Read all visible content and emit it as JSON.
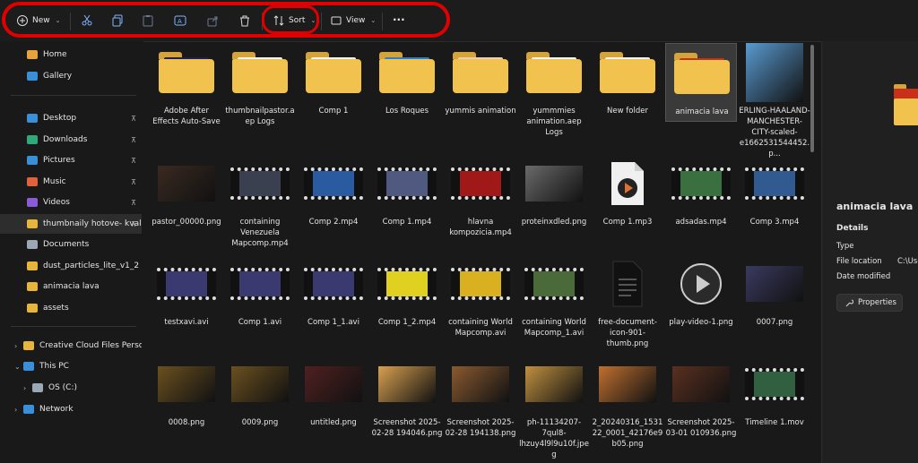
{
  "toolbar": {
    "new_label": "New",
    "sort_label": "Sort",
    "view_label": "View",
    "more_label": "···",
    "highlight_color": "#e00000"
  },
  "sidebar": {
    "items": [
      {
        "label": "Home",
        "icon": "home-icon",
        "color": "#e8a33a"
      },
      {
        "label": "Gallery",
        "icon": "gallery-icon",
        "color": "#3a8fd9"
      },
      {
        "label": "Desktop",
        "icon": "desktop-icon",
        "color": "#3a8fd9",
        "pinned": true
      },
      {
        "label": "Downloads",
        "icon": "downloads-icon",
        "color": "#2fa87a",
        "pinned": true
      },
      {
        "label": "Pictures",
        "icon": "pictures-icon",
        "color": "#3a8fd9",
        "pinned": true
      },
      {
        "label": "Music",
        "icon": "music-icon",
        "color": "#e0623a",
        "pinned": true
      },
      {
        "label": "Videos",
        "icon": "videos-icon",
        "color": "#8a5ad9",
        "pinned": true
      },
      {
        "label": "thumbnaily hotove- kvali",
        "icon": "folder-icon",
        "color": "#e6b53a",
        "pinned": true,
        "selected": true
      },
      {
        "label": "Documents",
        "icon": "documents-icon",
        "color": "#9aa7b5"
      },
      {
        "label": "dust_particles_lite_v1_2",
        "icon": "folder-icon",
        "color": "#e6b53a"
      },
      {
        "label": "animacia lava",
        "icon": "folder-icon",
        "color": "#e6b53a"
      },
      {
        "label": "assets",
        "icon": "folder-icon",
        "color": "#e6b53a"
      },
      {
        "label": "Creative Cloud Files Persona",
        "icon": "folder-icon",
        "color": "#e6b53a"
      },
      {
        "label": "This PC",
        "icon": "pc-icon",
        "color": "#3a8fd9"
      },
      {
        "label": "OS (C:)",
        "icon": "drive-icon",
        "color": "#9aa7b5"
      },
      {
        "label": "Network",
        "icon": "network-icon",
        "color": "#3a8fd9"
      }
    ]
  },
  "main": {
    "items": [
      {
        "label": "Adobe After Effects Auto-Save",
        "kind": "folder",
        "accent": "#1f1f5c"
      },
      {
        "label": "thumbnailpastor.aep Logs",
        "kind": "folder"
      },
      {
        "label": "Comp 1",
        "kind": "folder"
      },
      {
        "label": "Los Roques",
        "kind": "folder",
        "accent": "#2a7fd0"
      },
      {
        "label": "yummis animation",
        "kind": "folder",
        "accent": "#e8d0b0"
      },
      {
        "label": "yummmies animation.aep Logs",
        "kind": "folder"
      },
      {
        "label": "New folder",
        "kind": "folder"
      },
      {
        "label": "animacia lava",
        "kind": "folder",
        "accent": "#c8301a",
        "selected": true
      },
      {
        "label": "ERLING-HAALAND-MANCHESTER-CITY-scaled-e1662531544452.p...",
        "kind": "image",
        "accent": "#5a9ad0"
      },
      {
        "label": "pastor_00000.png",
        "kind": "image",
        "accent": "#3a2a20"
      },
      {
        "label": "containing Venezuela Mapcomp.mp4",
        "kind": "video",
        "accent": "#3a4050"
      },
      {
        "label": "Comp 2.mp4",
        "kind": "video",
        "accent": "#2a5aa0"
      },
      {
        "label": "Comp 1.mp4",
        "kind": "video",
        "accent": "#505a80"
      },
      {
        "label": "hlavna kompozicia.mp4",
        "kind": "video",
        "accent": "#a01818"
      },
      {
        "label": "proteinxdled.png",
        "kind": "image",
        "accent": "#6a6a6a"
      },
      {
        "label": "Comp 1.mp3",
        "kind": "audio"
      },
      {
        "label": "adsadas.mp4",
        "kind": "video",
        "accent": "#3a7040"
      },
      {
        "label": "Comp 3.mp4",
        "kind": "video",
        "accent": "#305a90"
      },
      {
        "label": "testxavi.avi",
        "kind": "video",
        "accent": "#3a3a70"
      },
      {
        "label": "Comp 1.avi",
        "kind": "video",
        "accent": "#3a3a70"
      },
      {
        "label": "Comp 1_1.avi",
        "kind": "video",
        "accent": "#3a3a70"
      },
      {
        "label": "Comp 1_2.mp4",
        "kind": "video",
        "accent": "#e0d020"
      },
      {
        "label": "containing World Mapcomp.avi",
        "kind": "video",
        "accent": "#d8b020"
      },
      {
        "label": "containing World Mapcomp_1.avi",
        "kind": "video",
        "accent": "#4a6a3a"
      },
      {
        "label": "free-document-icon-901-thumb.png",
        "kind": "document"
      },
      {
        "label": "play-video-1.png",
        "kind": "playicon"
      },
      {
        "label": "0007.png",
        "kind": "image",
        "accent": "#3a3a60"
      },
      {
        "label": "0008.png",
        "kind": "image",
        "accent": "#6a5020"
      },
      {
        "label": "0009.png",
        "kind": "image",
        "accent": "#6a5020"
      },
      {
        "label": "untitled.png",
        "kind": "image",
        "accent": "#502020"
      },
      {
        "label": "Screenshot 2025-02-28 194046.png",
        "kind": "image",
        "accent": "#d8a050"
      },
      {
        "label": "Screenshot 2025-02-28 194138.png",
        "kind": "image",
        "accent": "#8a5a30"
      },
      {
        "label": "ph-11134207-7qul8-lhzuy4l9l9u10f.jpeg",
        "kind": "image",
        "accent": "#c09040"
      },
      {
        "label": "2_20240316_153122_0001_42176e9b05.png",
        "kind": "image",
        "accent": "#c07030"
      },
      {
        "label": "Screenshot 2025-03-01 010936.png",
        "kind": "image",
        "accent": "#5a3020"
      },
      {
        "label": "Timeline 1.mov",
        "kind": "video",
        "accent": "#306040"
      }
    ]
  },
  "details": {
    "title": "animacia lava",
    "section": "Details",
    "type_label": "Type",
    "location_label": "File location",
    "location_value": "C:\\Use",
    "modified_label": "Date modified",
    "properties_label": "Properties"
  }
}
